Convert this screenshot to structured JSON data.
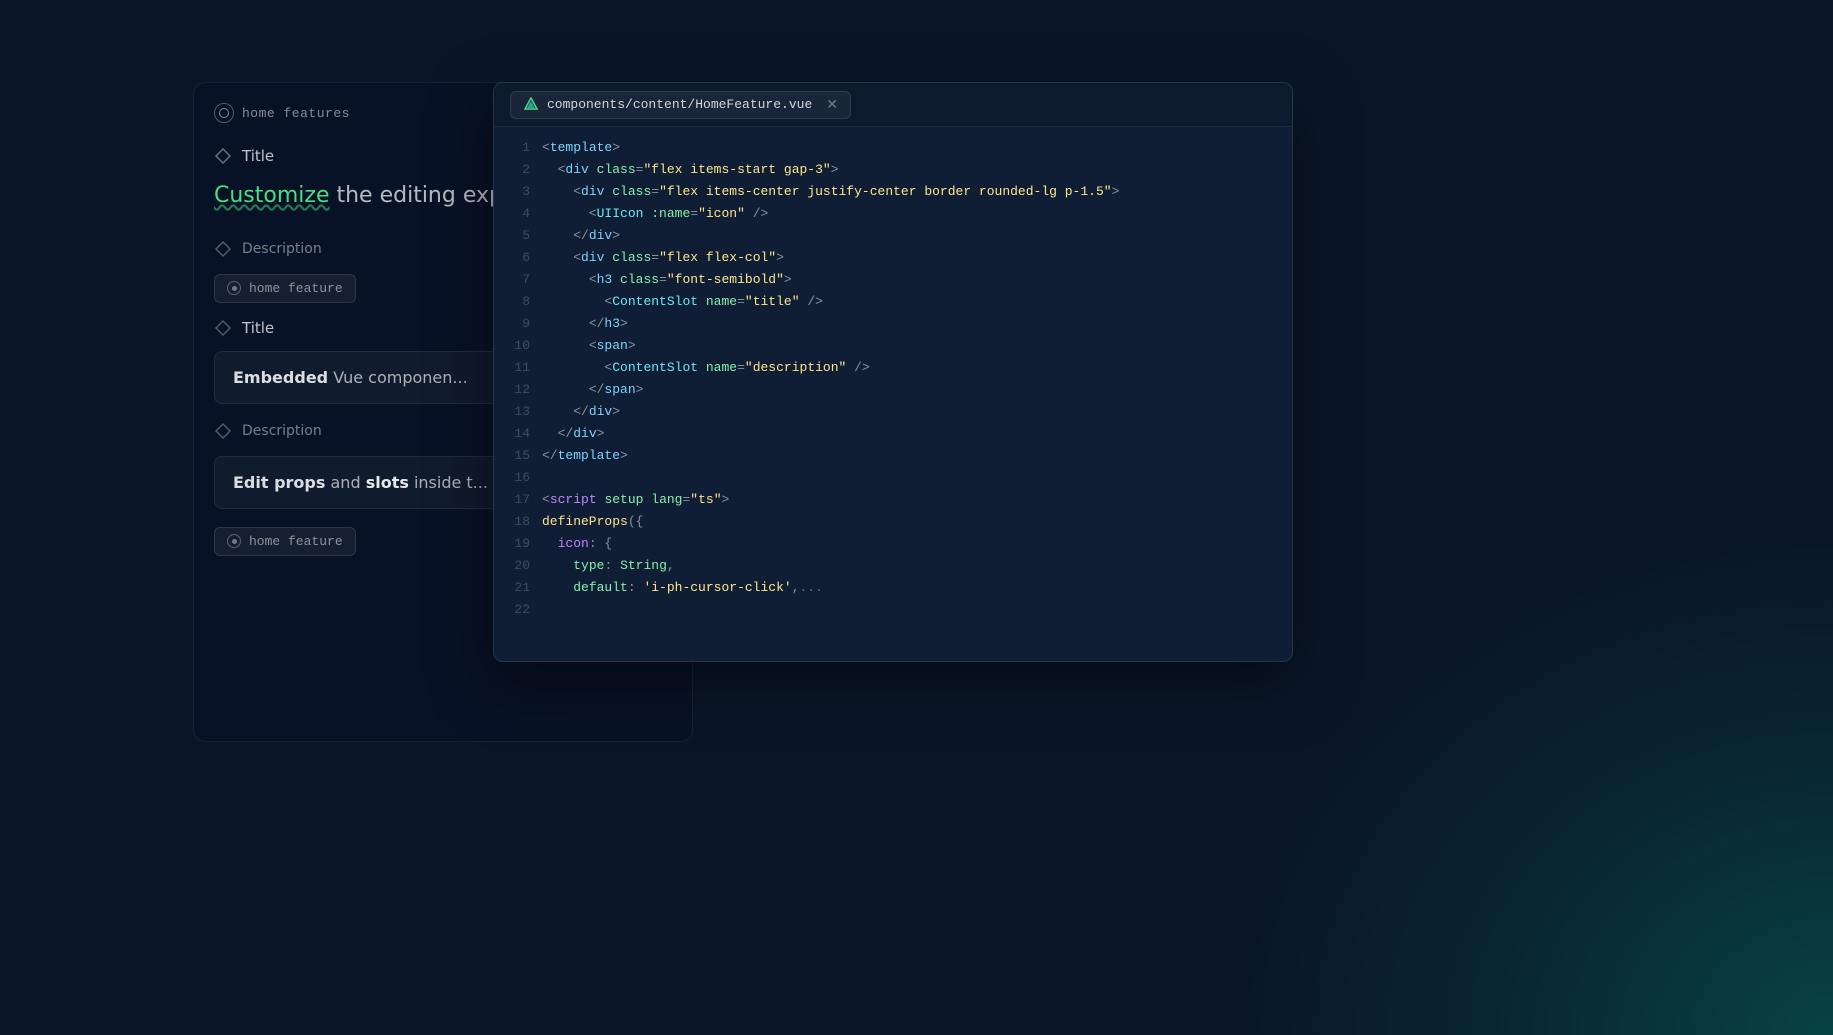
{
  "background": {
    "glow": true
  },
  "left_panel": {
    "breadcrumb": {
      "text": "home features"
    },
    "title_section": {
      "label": "Title",
      "chevron": "▾"
    },
    "customize_text": {
      "highlight": "Customize",
      "rest": " the editing experie..."
    },
    "description_section": {
      "label": "Description"
    },
    "component_badge_1": {
      "text": "home feature"
    },
    "title_section_2": {
      "label": "Title"
    },
    "content_card_1": {
      "text_bold": "Embedded",
      "text_rest": " Vue componen..."
    },
    "description_section_2": {
      "label": "Description"
    },
    "content_card_2": {
      "text_bold": "Edit props",
      "text_rest": " and ",
      "text_code": "slots",
      "text_end": " inside t..."
    },
    "component_badge_2": {
      "text": "home feature"
    }
  },
  "code_panel": {
    "file_tab": {
      "name": "components/content/HomeFeature.vue"
    },
    "lines": [
      {
        "num": 1,
        "content": "<template>"
      },
      {
        "num": 2,
        "content": "  <div class=\"flex items-start gap-3\">"
      },
      {
        "num": 3,
        "content": "    <div class=\"flex items-center justify-center border rounded-lg p-1.5\">"
      },
      {
        "num": 4,
        "content": "      <UIIcon :name=\"icon\" />"
      },
      {
        "num": 5,
        "content": "    </div>"
      },
      {
        "num": 6,
        "content": "    <div class=\"flex flex-col\">"
      },
      {
        "num": 7,
        "content": "      <h3 class=\"font-semibold\">"
      },
      {
        "num": 8,
        "content": "        <ContentSlot name=\"title\" />"
      },
      {
        "num": 9,
        "content": "      </h3>"
      },
      {
        "num": 10,
        "content": "      <span>"
      },
      {
        "num": 11,
        "content": "        <ContentSlot name=\"description\" />"
      },
      {
        "num": 12,
        "content": "      </span>"
      },
      {
        "num": 13,
        "content": "    </div>"
      },
      {
        "num": 14,
        "content": "  </div>"
      },
      {
        "num": 15,
        "content": "</template>"
      },
      {
        "num": 16,
        "content": ""
      },
      {
        "num": 17,
        "content": "<script setup lang=\"ts\">"
      },
      {
        "num": 18,
        "content": "defineProps({"
      },
      {
        "num": 19,
        "content": "  icon: {"
      },
      {
        "num": 20,
        "content": "    type: String,"
      },
      {
        "num": 21,
        "content": "    default: 'i-ph-cursor-click',..."
      },
      {
        "num": 22,
        "content": ""
      }
    ]
  }
}
